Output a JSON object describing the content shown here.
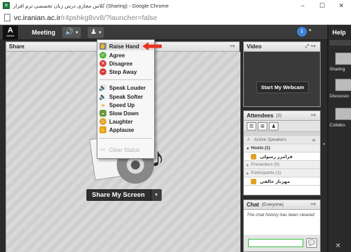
{
  "browser": {
    "title": "کلاس مجازی درس زبان تخصصی ترم افزار (Sharing) - Google Chrome",
    "url_host": "vc.iranian.ac.ir",
    "url_path": "/r4pshkg8vv8/?launcher=false",
    "minimize": "–",
    "maximize": "☐",
    "close": "✕"
  },
  "connect": {
    "logo_letter": "A",
    "logo_sub": "Adobe",
    "meeting_menu": "Meeting",
    "caret": "▾",
    "help": "Help"
  },
  "share_pod": {
    "title": "Share",
    "share_button": "Share My Screen",
    "share_caret": "▾"
  },
  "status_menu": {
    "items": [
      {
        "label": "Raise Hand",
        "icon": "hand-icon",
        "color": "#8a8a8a"
      },
      {
        "label": "Agree",
        "icon": "agree-icon",
        "color": "#5ab848"
      },
      {
        "label": "Disagree",
        "icon": "disagree-icon",
        "color": "#d83c3c"
      },
      {
        "label": "Step Away",
        "icon": "step-away-icon",
        "color": "#d83c3c"
      },
      {
        "label": "Speak Louder",
        "icon": "speaker-louder-icon",
        "color": "#d0503c"
      },
      {
        "label": "Speak Softer",
        "icon": "speaker-softer-icon",
        "color": "#666666"
      },
      {
        "label": "Speed Up",
        "icon": "speed-up-icon",
        "color": "#e0a020"
      },
      {
        "label": "Slow Down",
        "icon": "slow-down-icon",
        "color": "#6a9a3a"
      },
      {
        "label": "Laughter",
        "icon": "laughter-icon",
        "color": "#e0a020"
      },
      {
        "label": "Applause",
        "icon": "applause-icon",
        "color": "#e0a020"
      },
      {
        "label": "Clear Status",
        "icon": "clear-status-icon",
        "color": "#cccccc"
      }
    ]
  },
  "video_pod": {
    "title": "Video",
    "webcam_button": "Start My Webcam"
  },
  "attendees_pod": {
    "title": "Attendees",
    "count": "(2)",
    "active_speakers": "Active Speakers",
    "hosts": "Hosts (1)",
    "host_name": "فرامرز رسولی",
    "presenters": "Presenters (0)",
    "participants": "Participants (1)",
    "participant_name": "مهرناز خالقی"
  },
  "chat_pod": {
    "title": "Chat",
    "scope": "(Everyone)",
    "message": "The chat history has been cleared"
  },
  "sidebar": {
    "sharing": "Sharing",
    "discussion": "Discussio",
    "collaboration": "Collabo."
  }
}
